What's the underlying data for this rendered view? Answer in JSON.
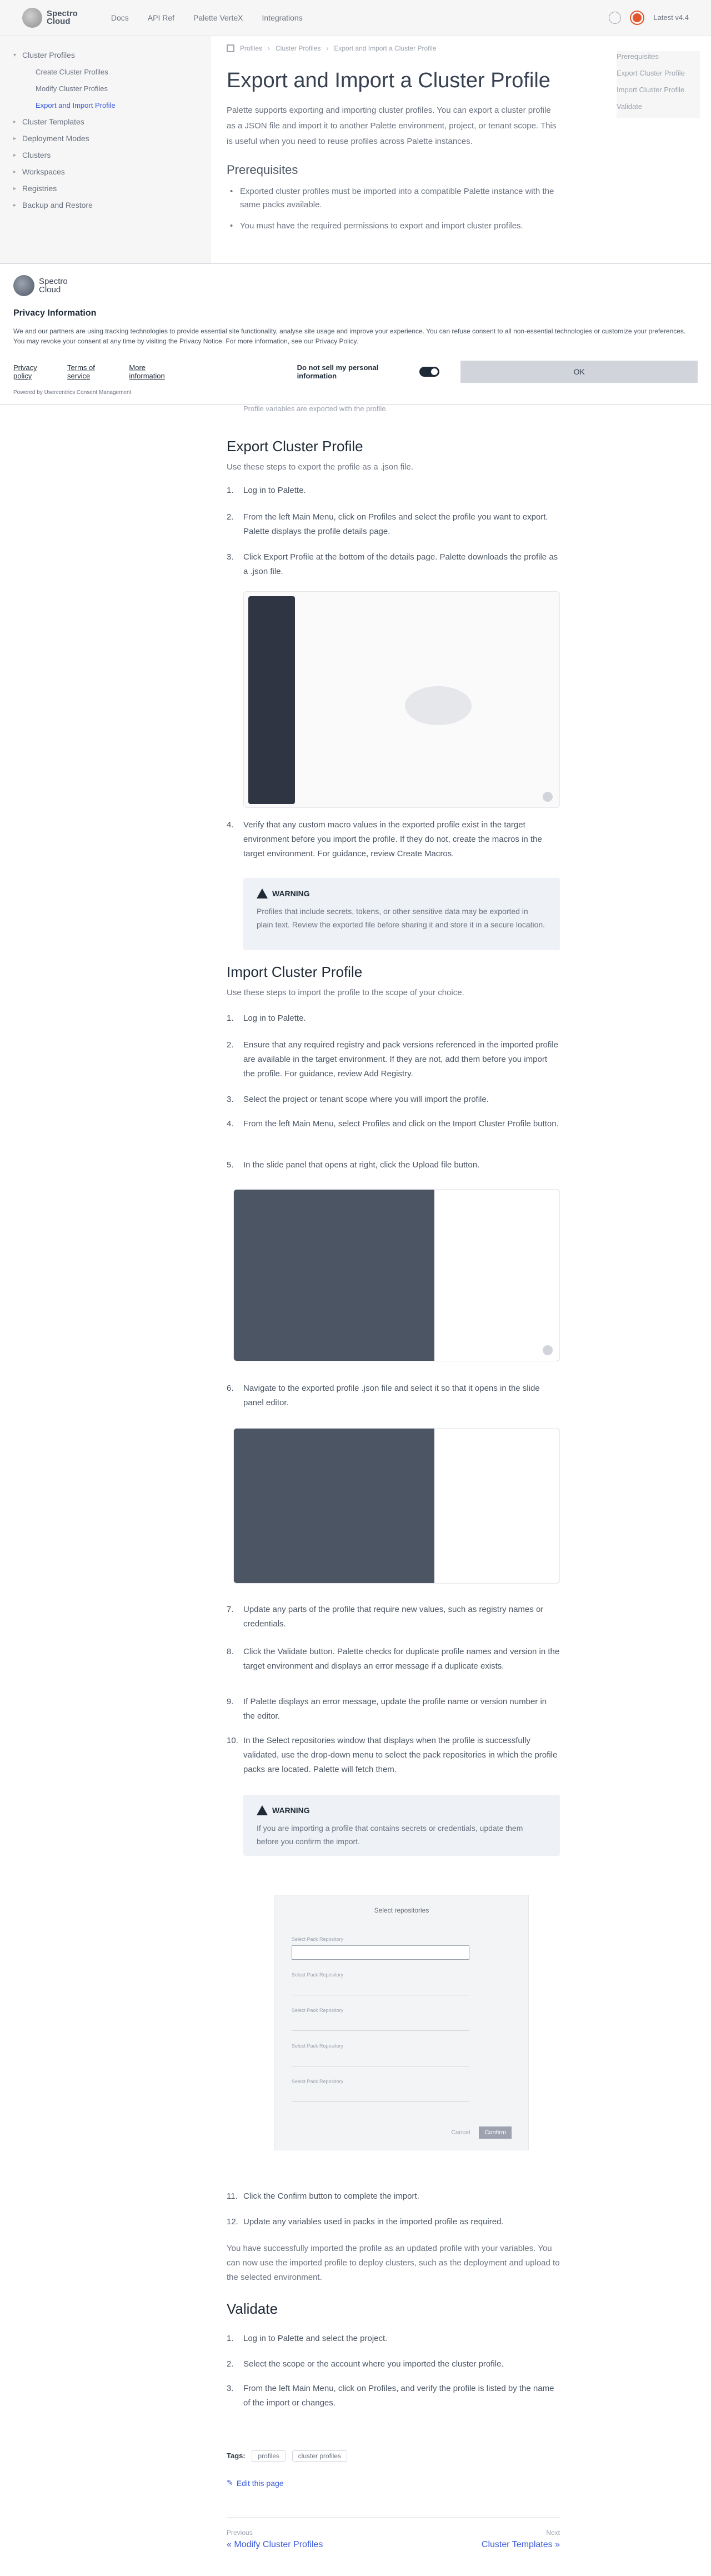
{
  "header": {
    "logo_text_1": "Spectro",
    "logo_text_2": "Cloud",
    "nav": [
      "Docs",
      "API Ref",
      "Palette VerteX",
      "Integrations"
    ],
    "version_label": "Latest v4.4"
  },
  "sidebar": {
    "items": [
      {
        "label": "Cluster Profiles",
        "sub": false,
        "active": false
      },
      {
        "label": "Create Cluster Profiles",
        "sub": true,
        "active": false
      },
      {
        "label": "Modify Cluster Profiles",
        "sub": true,
        "active": false
      },
      {
        "label": "Export and Import Profile",
        "sub": true,
        "active": true
      },
      {
        "label": "Cluster Templates",
        "sub": false,
        "active": false
      },
      {
        "label": "Deployment Modes",
        "sub": false,
        "active": false
      },
      {
        "label": "Clusters",
        "sub": false,
        "active": false
      },
      {
        "label": "Workspaces",
        "sub": false,
        "active": false
      },
      {
        "label": "Registries",
        "sub": false,
        "active": false
      },
      {
        "label": "Backup and Restore",
        "sub": false,
        "active": false
      }
    ]
  },
  "toc": [
    "Prerequisites",
    "Export Cluster Profile",
    "Import Cluster Profile",
    "Validate"
  ],
  "breadcrumb": [
    "Profiles",
    "Cluster Profiles",
    "Export and Import a Cluster Profile"
  ],
  "page": {
    "title": "Export and Import a Cluster Profile",
    "intro": "Palette supports exporting and importing cluster profiles. You can export a cluster profile as a JSON file and import it to another Palette environment, project, or tenant scope. This is useful when you need to reuse profiles across Palette instances.",
    "prereq_title": "Prerequisites",
    "prereq_1": "Exported cluster profiles must be imported into a compatible Palette instance with the same packs available.",
    "prereq_2": "You must have the required permissions to export and import cluster profiles."
  },
  "cookie": {
    "logo_1": "Spectro",
    "logo_2": "Cloud",
    "title": "Privacy Information",
    "description": "We and our partners are using tracking technologies to provide essential site functionality, analyse site usage and improve your experience. You can refuse consent to all non-essential technologies or customize your preferences. You may revoke your consent at any time by visiting the Privacy Notice. For more information, see our Privacy Policy.",
    "links": [
      "Privacy policy",
      "Terms of service",
      "More information"
    ],
    "toggle_label": "Do not sell my personal information",
    "ok_label": "OK",
    "powered": "Powered by Usercentrics Consent Management"
  },
  "export": {
    "top_note": "Profile variables are exported with the profile.",
    "title": "Export Cluster Profile",
    "lead": "Use these steps to export the profile as a .json file.",
    "steps": [
      "Log in to Palette.",
      "From the left Main Menu, click on Profiles and select the profile you want to export. Palette displays the profile details page.",
      "Click Export Profile at the bottom of the details page. Palette downloads the profile as a .json file.",
      "Verify that any custom macro values in the exported profile exist in the target environment before you import the profile. If they do not, create the macros in the target environment. For guidance, review Create Macros."
    ],
    "callout_title": "WARNING",
    "callout_text": "Profiles that include secrets, tokens, or other sensitive data may be exported in plain text. Review the exported file before sharing it and store it in a secure location."
  },
  "import": {
    "title": "Import Cluster Profile",
    "lead": "Use these steps to import the profile to the scope of your choice.",
    "steps": [
      "Log in to Palette.",
      "Ensure that any required registry and pack versions referenced in the imported profile are available in the target environment. If they are not, add them before you import the profile. For guidance, review Add Registry.",
      "Select the project or tenant scope where you will import the profile.",
      "From the left Main Menu, select Profiles and click on the Import Cluster Profile button.",
      "In the slide panel that opens at right, click the Upload file button.",
      "Navigate to the exported profile .json file and select it so that it opens in the slide panel editor.",
      "Update any parts of the profile that require new values, such as registry names or credentials.",
      "Click the Validate button. Palette checks for duplicate profile names and version in the target environment and displays an error message if a duplicate exists.",
      "If Palette displays an error message, update the profile name or version number in the editor.",
      "In the Select repositories window that displays when the profile is successfully validated, use the drop-down menu to select the pack repositories in which the profile packs are located. Palette will fetch them."
    ],
    "callout_title": "WARNING",
    "callout_text": "If you are importing a profile that contains secrets or credentials, update them before you confirm the import.",
    "dialog_title": "Select repositories",
    "dialog_fields": [
      "Select Pack Repository",
      "Select Pack Repository",
      "Select Pack Repository",
      "Select Pack Repository",
      "Select Pack Repository"
    ],
    "dialog_cancel": "Cancel",
    "dialog_confirm": "Confirm",
    "steps_after": [
      "Click the Confirm button to complete the import.",
      "Update any variables used in packs in the imported profile as required."
    ],
    "outro": "You have successfully imported the profile as an updated profile with your variables. You can now use the imported profile to deploy clusters, such as the deployment and upload to the selected environment."
  },
  "validate": {
    "title": "Validate",
    "steps": [
      "Log in to Palette and select the project.",
      "Select the scope or the account where you imported the cluster profile.",
      "From the left Main Menu, click on Profiles, and verify the profile is listed by the name of the import or changes."
    ]
  },
  "footer": {
    "tags_label": "Tags:",
    "tags": [
      "profiles",
      "cluster profiles"
    ],
    "edit_label": "Edit this page",
    "prev_label": "Previous",
    "prev_title": "« Modify Cluster Profiles",
    "next_label": "Next",
    "next_title": "Cluster Templates »"
  }
}
